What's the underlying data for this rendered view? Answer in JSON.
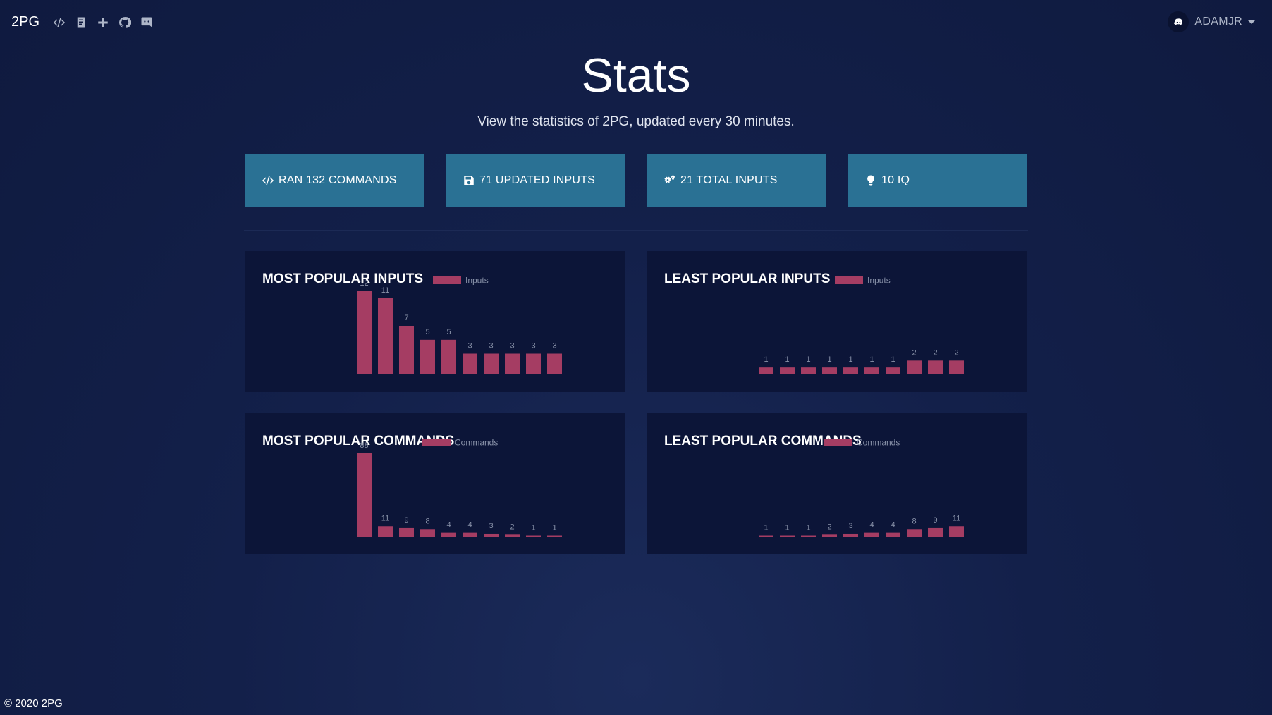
{
  "brand": "2PG",
  "nav_icons": [
    "code-icon",
    "book-icon",
    "plus-icon",
    "github-icon",
    "discord-icon"
  ],
  "user": {
    "name": "ADAMJR",
    "avatar_icon": "discord-icon"
  },
  "header": {
    "title": "Stats",
    "subtitle": "View the statistics of 2PG, updated every 30 minutes."
  },
  "stats": [
    {
      "icon": "code-icon",
      "label": "RAN 132 COMMANDS"
    },
    {
      "icon": "save-icon",
      "label": "71 UPDATED INPUTS"
    },
    {
      "icon": "cogs-icon",
      "label": "21 TOTAL INPUTS"
    },
    {
      "icon": "lightbulb-icon",
      "label": "10 IQ"
    }
  ],
  "colors": {
    "bar": "#a53d63",
    "button": "#2a7194",
    "card": "#0c1538",
    "label": "#8891a8"
  },
  "chart_data": [
    {
      "id": "most-popular-inputs",
      "type": "bar",
      "title": "MOST POPULAR INPUTS",
      "legend": "Inputs",
      "values": [
        12,
        11,
        7,
        5,
        5,
        3,
        3,
        3,
        3,
        3
      ],
      "ylim": [
        0,
        12
      ]
    },
    {
      "id": "least-popular-inputs",
      "type": "bar",
      "title": "LEAST POPULAR INPUTS",
      "legend": "Inputs",
      "values": [
        1,
        1,
        1,
        1,
        1,
        1,
        1,
        2,
        2,
        2
      ],
      "ylim": [
        0,
        12
      ]
    },
    {
      "id": "most-popular-commands",
      "type": "bar",
      "title": "MOST POPULAR COMMANDS",
      "legend": "Commands",
      "values": [
        88,
        11,
        9,
        8,
        4,
        4,
        3,
        2,
        1,
        1
      ],
      "ylim": [
        0,
        88
      ]
    },
    {
      "id": "least-popular-commands",
      "type": "bar",
      "title": "LEAST POPULAR COMMANDS",
      "legend": "Commands",
      "values": [
        1,
        1,
        1,
        2,
        3,
        4,
        4,
        8,
        9,
        11
      ],
      "ylim": [
        0,
        88
      ]
    }
  ],
  "footer": "© 2020 2PG"
}
